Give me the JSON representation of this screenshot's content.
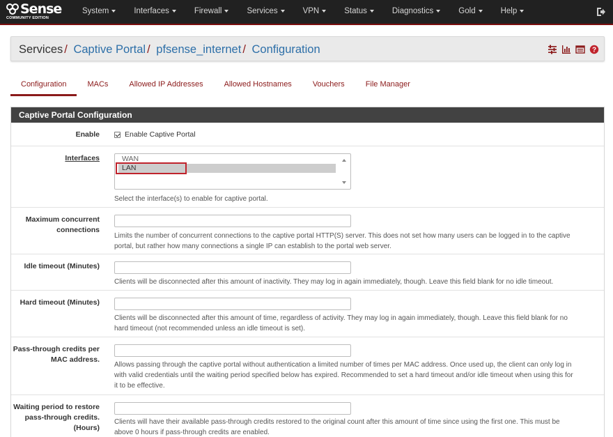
{
  "brand": {
    "name": "Sense",
    "edition": "COMMUNITY EDITION"
  },
  "nav": [
    {
      "label": "System"
    },
    {
      "label": "Interfaces"
    },
    {
      "label": "Firewall"
    },
    {
      "label": "Services"
    },
    {
      "label": "VPN"
    },
    {
      "label": "Status"
    },
    {
      "label": "Diagnostics"
    },
    {
      "label": "Gold"
    },
    {
      "label": "Help"
    }
  ],
  "breadcrumb": {
    "root": "Services",
    "items": [
      "Captive Portal",
      "pfsense_internet",
      "Configuration"
    ],
    "separator": "/"
  },
  "tabs": [
    {
      "label": "Configuration",
      "active": true
    },
    {
      "label": "MACs"
    },
    {
      "label": "Allowed IP Addresses"
    },
    {
      "label": "Allowed Hostnames"
    },
    {
      "label": "Vouchers"
    },
    {
      "label": "File Manager"
    }
  ],
  "panel": {
    "title": "Captive Portal Configuration",
    "enable": {
      "label": "Enable",
      "checkbox_label": "Enable Captive Portal",
      "checked": true
    },
    "interfaces": {
      "label": "Interfaces",
      "options": [
        "WAN",
        "LAN"
      ],
      "selected": "LAN",
      "help": "Select the interface(s) to enable for captive portal."
    },
    "max_conn": {
      "label_line1": "Maximum concurrent",
      "label_line2": "connections",
      "value": "",
      "help_line1": "Limits the number of concurrent connections to the captive portal HTTP(S) server. This does not set how many users can be logged in to the captive",
      "help_line2": "portal, but rather how many connections a single IP can establish to the portal web server."
    },
    "idle_timeout": {
      "label": "Idle timeout (Minutes)",
      "value": "",
      "help": "Clients will be disconnected after this amount of inactivity. They may log in again immediately, though. Leave this field blank for no idle timeout."
    },
    "hard_timeout": {
      "label": "Hard timeout (Minutes)",
      "value": "",
      "help_line1": "Clients will be disconnected after this amount of time, regardless of activity. They may log in again immediately, though. Leave this field blank for no",
      "help_line2": "hard timeout (not recommended unless an idle timeout is set)."
    },
    "passthrough": {
      "label_line1": "Pass-through credits per",
      "label_line2": "MAC address.",
      "value": "",
      "help_line1": "Allows passing through the captive portal without authentication a limited number of times per MAC address. Once used up, the client can only log in",
      "help_line2": "with valid credentials until the waiting period specified below has expired. Recommended to set a hard timeout and/or idle timeout when using this for",
      "help_line3": "it to be effective."
    },
    "waiting": {
      "label_line1": "Waiting period to restore",
      "label_line2": "pass-through credits.",
      "label_line3": "(Hours)",
      "value": "",
      "help_line1": "Clients will have their available pass-through credits restored to the original count after this amount of time since using the first one. This must be",
      "help_line2": "above 0 hours if pass-through credits are enabled."
    }
  },
  "colors": {
    "navbar": "#212121",
    "accent": "#8b1a1a",
    "link": "#2d6fa8",
    "panel_head": "#424242",
    "highlight_box": "#c0232c"
  },
  "icons": [
    "sliders-icon",
    "bar-chart-icon",
    "list-table-icon",
    "help-circle-icon",
    "logout-icon"
  ]
}
